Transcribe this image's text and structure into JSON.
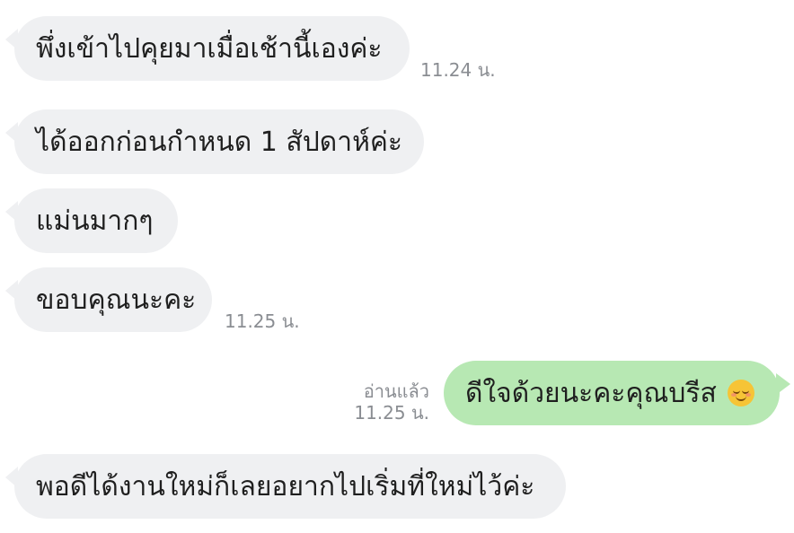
{
  "messages": [
    {
      "text": "พึ่งเข้าไปคุยมาเมื่อเช้านี้เองค่ะ",
      "time": "11.24 น."
    },
    {
      "text": "ได้ออกก่อนกำหนด 1 สัปดาห์ค่ะ"
    },
    {
      "text": "แม่นมากๆ"
    },
    {
      "text": "ขอบคุณนะคะ",
      "time": "11.25 น."
    },
    {
      "text": "ดีใจด้วยนะคะคุณบรีส",
      "emoji": "smiling-face-with-closed-eyes",
      "read_label": "อ่านแล้ว",
      "time": "11.25 น."
    },
    {
      "text": "พอดีได้งานใหม่ก็เลยอยากไปเริ่มที่ใหม่ไว้ค่ะ"
    }
  ]
}
